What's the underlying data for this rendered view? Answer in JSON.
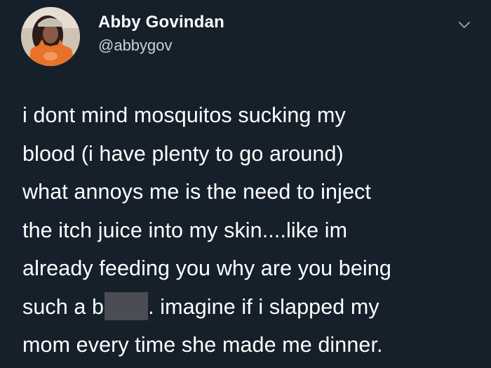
{
  "author": {
    "display_name": "Abby Govindan",
    "handle": "@abbygov",
    "avatar_icon": "profile-photo"
  },
  "menu": {
    "icon": "chevron-down-icon"
  },
  "tweet": {
    "lines": [
      "i dont mind mosquitos sucking my",
      "blood (i have plenty to go around)",
      "what annoys me is the need to inject",
      "the itch juice into my skin....like im",
      "already feeding you why are you being"
    ],
    "line6_before": "such a b",
    "line6_after": ". imagine if i slapped my",
    "line7": "mom every time she made me dinner."
  },
  "colors": {
    "background": "#15202b",
    "text": "#ffffff",
    "handle": "#c9d1d9",
    "censor_block": "#4a4e54"
  }
}
